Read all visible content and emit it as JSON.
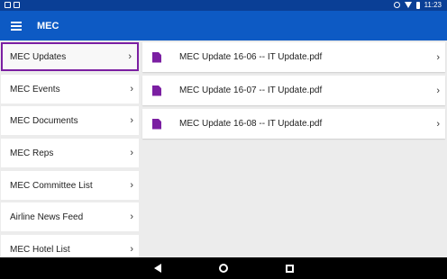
{
  "statusbar": {
    "time": "11:23"
  },
  "appbar": {
    "title": "MEC"
  },
  "sidebar": {
    "items": [
      {
        "label": "MEC Updates",
        "active": true
      },
      {
        "label": "MEC Events"
      },
      {
        "label": "MEC Documents"
      },
      {
        "label": "MEC Reps"
      },
      {
        "label": "MEC Committee List"
      },
      {
        "label": "Airline News Feed"
      },
      {
        "label": "MEC Hotel List"
      }
    ]
  },
  "files": [
    {
      "name": "MEC Update 16-06 -- IT Update.pdf"
    },
    {
      "name": "MEC Update 16-07 -- IT Update.pdf"
    },
    {
      "name": "MEC Update 16-08 -- IT Update.pdf"
    }
  ],
  "colors": {
    "appbar": "#0d5ac4",
    "statusbar": "#0a3f96",
    "accent": "#7b1fa2"
  },
  "icons": {
    "menu": "hamburger-menu-icon",
    "file": "pdf-file-icon",
    "chevron": "chevron-right-icon"
  }
}
